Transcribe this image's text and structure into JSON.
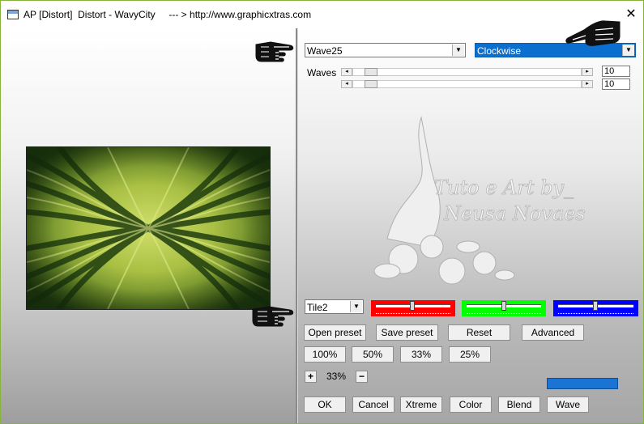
{
  "window": {
    "title": "AP [Distort]  Distort - WavyCity     --- > http://www.graphicxtras.com",
    "close_glyph": "✕"
  },
  "controls": {
    "preset_dropdown": "Wave25",
    "direction_dropdown": "Clockwise",
    "waves_label": "Waves",
    "slider1_value": "10",
    "slider2_value": "10",
    "tile_dropdown": "Tile2"
  },
  "color_sliders": {
    "red": "#ff0000",
    "green": "#00ff00",
    "blue": "#0000ff"
  },
  "buttons": {
    "open_preset": "Open preset",
    "save_preset": "Save preset",
    "reset": "Reset",
    "advanced": "Advanced",
    "zoom_100": "100%",
    "zoom_50": "50%",
    "zoom_33": "33%",
    "zoom_25": "25%",
    "zoom_plus": "+",
    "zoom_minus": "−",
    "zoom_current": "33%",
    "ok": "OK",
    "cancel": "Cancel",
    "xtreme": "Xtreme",
    "color": "Color",
    "blend": "Blend",
    "wave": "Wave"
  },
  "watermark": {
    "line1": "Tuto e Art by_",
    "line2": "Neusa Novaes"
  },
  "icons": {
    "app": "app-window-icon",
    "close": "close-icon",
    "pointer": "pointing-hand-icon"
  },
  "colors": {
    "window_border": "#86b33a",
    "selection_blue": "#0b6fd0",
    "preview_light": "#c9d95a",
    "preview_dark": "#1c3a10"
  }
}
